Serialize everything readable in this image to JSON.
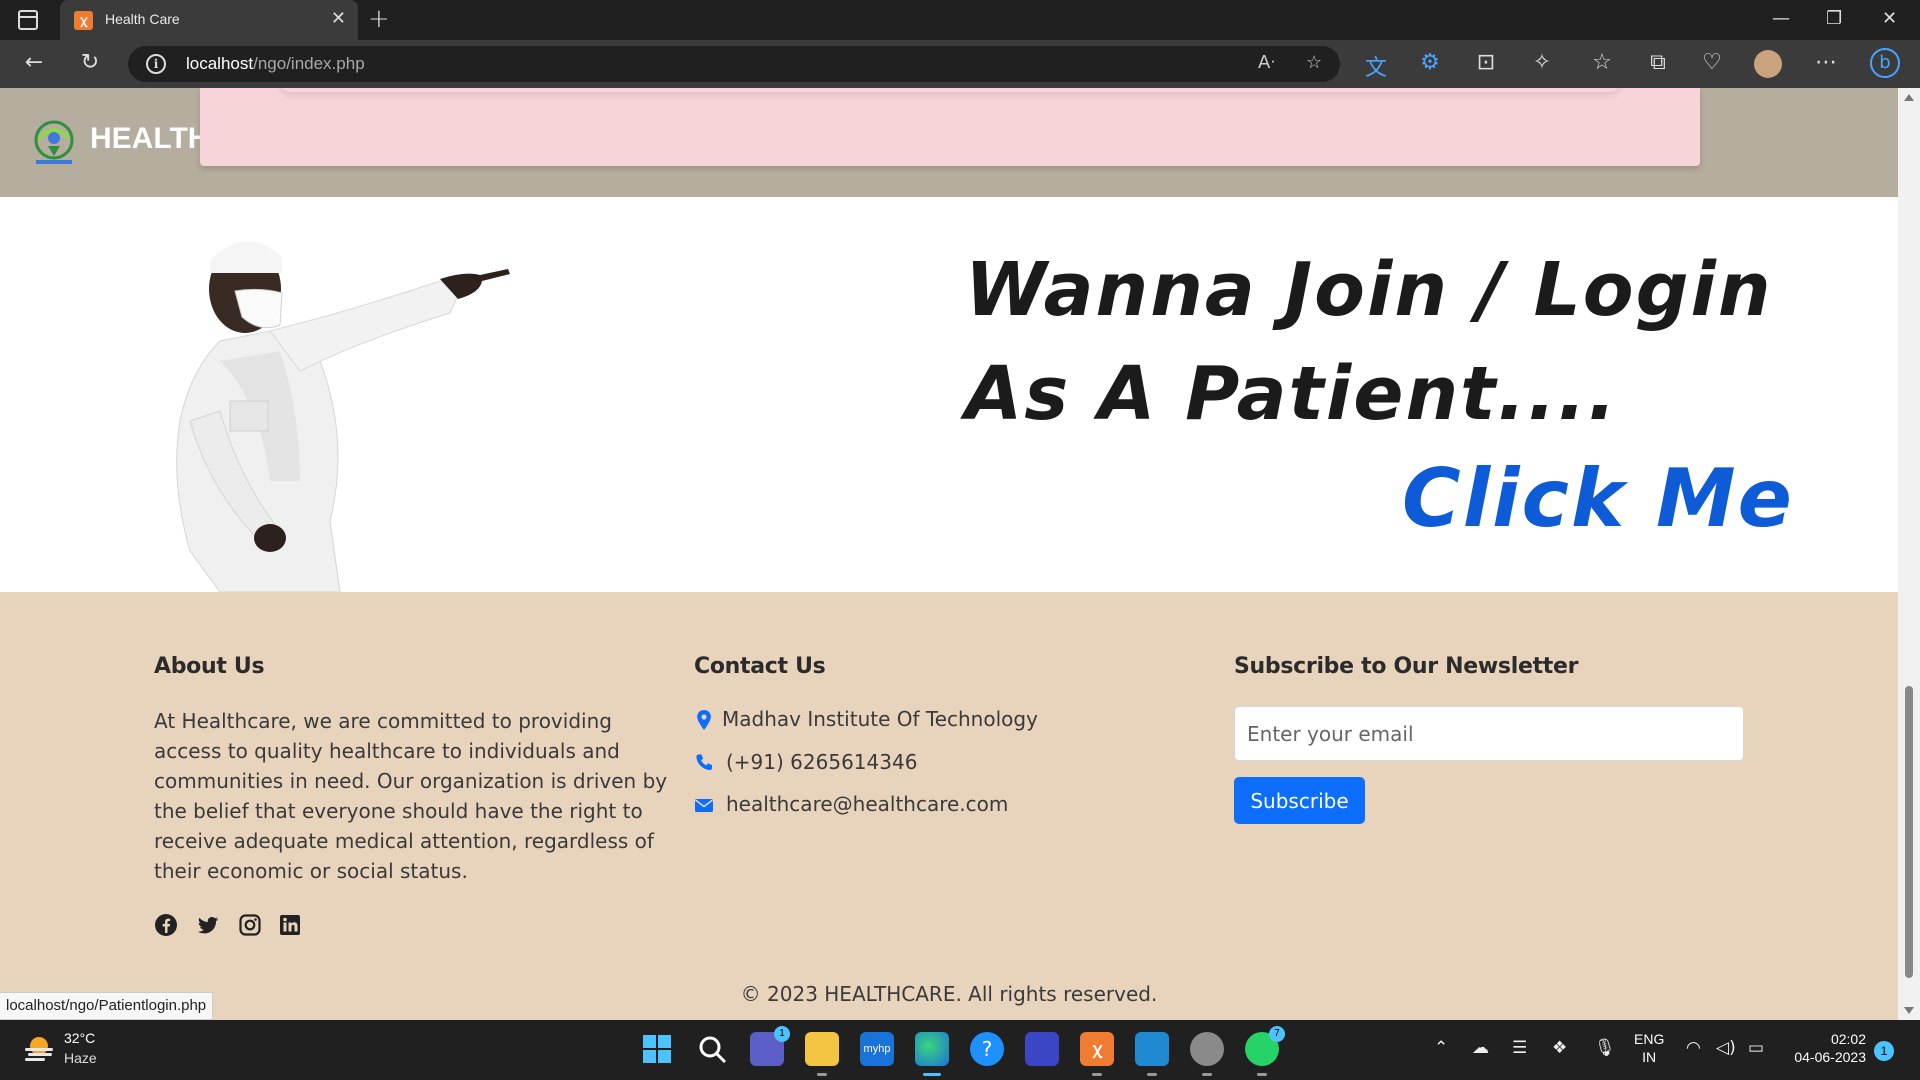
{
  "browser": {
    "tab_title": "Health Care",
    "tab_close": "✕",
    "new_tab": "+",
    "url_host": "localhost",
    "url_path": "/ngo/index.php",
    "status_url": "localhost/ngo/Patientlogin.php"
  },
  "header": {
    "logo_text": "HEALTH"
  },
  "hero": {
    "line1": "Wanna Join / Login",
    "line2": "As A Patient....",
    "cta": "Click Me"
  },
  "footer": {
    "about": {
      "heading": "About Us",
      "text": "At Healthcare, we are committed to providing access to quality healthcare to individuals and communities in need. Our organization is driven by the belief that everyone should have the right to receive adequate medical attention, regardless of their economic or social status."
    },
    "contact": {
      "heading": "Contact Us",
      "address": "Madhav Institute Of Technology",
      "phone": "(+91) 6265614346",
      "email": "healthcare@healthcare.com"
    },
    "newsletter": {
      "heading": "Subscribe to Our Newsletter",
      "placeholder": "Enter your email",
      "button": "Subscribe"
    },
    "copyright": "© 2023 HEALTHCARE. All rights reserved."
  },
  "taskbar": {
    "weather_temp": "32°C",
    "weather_desc": "Haze",
    "lang_line1": "ENG",
    "lang_line2": "IN",
    "time": "02:02",
    "date": "04-06-2023",
    "notification_count": "1",
    "teams_badge": "1",
    "whatsapp_badge": "7"
  },
  "colors": {
    "header_bg": "#b5ad9d",
    "footer_bg": "#e8d4bd",
    "cta_blue": "#0d5bd6",
    "button_blue": "#0d6efd",
    "pink_panel": "#f6d4d8"
  }
}
